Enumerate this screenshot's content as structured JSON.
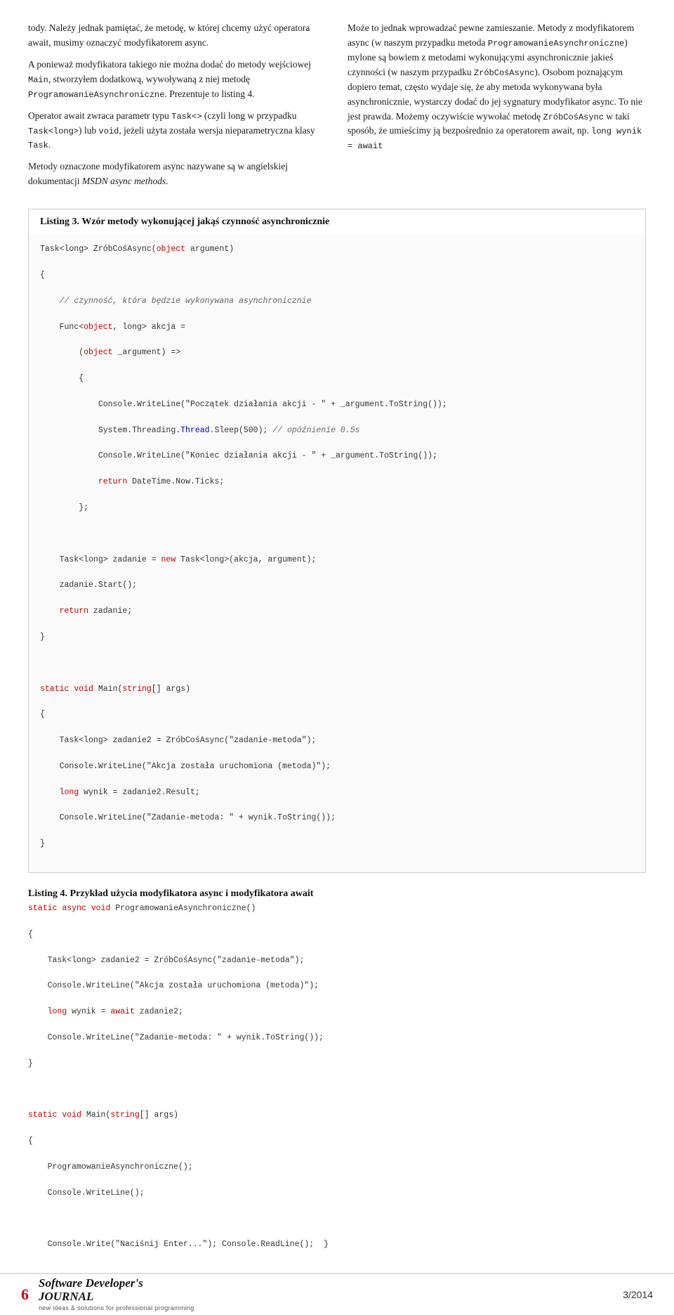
{
  "page": {
    "page_number": "6",
    "issue": "3/2014"
  },
  "footer": {
    "page_number": "6",
    "logo_main": "Software Developer's",
    "logo_sub": "new ideas & solutions for professional programming",
    "logo_journal": "JOURNAL",
    "issue": "3/2014"
  },
  "left_column": {
    "paragraphs": [
      "tody. Należy jednak pamiętać, że metodę, w której chcemy użyć operatora await, musimy oznaczyć modyfikatorem async.",
      "A ponieważ modyfikatora takiego nie można dodać do metody wejściowej Main, stworzyłem dodatkową, wywoływaną z niej metodę ProgramowanieAsynchroniczne. Prezentuje to listing 4.",
      "Operator await zwraca parametr typu Task<> (czyli long w przypadku Task<long>) lub void, jeżeli użyta została wersja nieparametryczna klasy Task.",
      "Metody oznaczone modyfikatorem async nazywane są w angielskiej dokumentacji MSDN async methods."
    ]
  },
  "right_column": {
    "paragraphs": [
      "Może to jednak wprowadzać pewne zamieszanie. Metody z modyfikatorem async (w naszym przypadku metoda ProgramowanieAsynchroniczne) mylone są bowiem z metodami wykonującymi asynchronicznie jakieś czynności (w naszym przypadku ZróbCośAsync). Osobom poznającym dopiero temat, często wydaje się, że aby metoda wykonywana była asynchronicznie, wystarczy dodać do jej sygnatury modyfikator async. To nie jest prawda. Możemy oczywiście wywołać metodę ZróbCośAsync w taki sposób, że umieścimy ją bezpośrednio za operatorem await, np. long wynik = await"
    ]
  },
  "listing3": {
    "title": "Listing 3. Wzór metody wykonującej jakąś czynność asynchronicznie"
  },
  "listing4": {
    "title": "Listing 4. Przykład użycia modyfikatora async i modyfikatora await"
  }
}
